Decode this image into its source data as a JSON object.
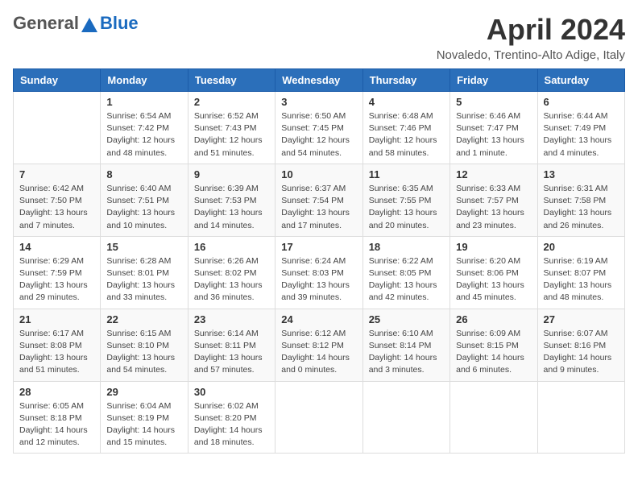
{
  "logo": {
    "general": "General",
    "blue": "Blue"
  },
  "header": {
    "title": "April 2024",
    "location": "Novaledo, Trentino-Alto Adige, Italy"
  },
  "days_of_week": [
    "Sunday",
    "Monday",
    "Tuesday",
    "Wednesday",
    "Thursday",
    "Friday",
    "Saturday"
  ],
  "weeks": [
    [
      {
        "day": "",
        "sunrise": "",
        "sunset": "",
        "daylight": ""
      },
      {
        "day": "1",
        "sunrise": "Sunrise: 6:54 AM",
        "sunset": "Sunset: 7:42 PM",
        "daylight": "Daylight: 12 hours and 48 minutes."
      },
      {
        "day": "2",
        "sunrise": "Sunrise: 6:52 AM",
        "sunset": "Sunset: 7:43 PM",
        "daylight": "Daylight: 12 hours and 51 minutes."
      },
      {
        "day": "3",
        "sunrise": "Sunrise: 6:50 AM",
        "sunset": "Sunset: 7:45 PM",
        "daylight": "Daylight: 12 hours and 54 minutes."
      },
      {
        "day": "4",
        "sunrise": "Sunrise: 6:48 AM",
        "sunset": "Sunset: 7:46 PM",
        "daylight": "Daylight: 12 hours and 58 minutes."
      },
      {
        "day": "5",
        "sunrise": "Sunrise: 6:46 AM",
        "sunset": "Sunset: 7:47 PM",
        "daylight": "Daylight: 13 hours and 1 minute."
      },
      {
        "day": "6",
        "sunrise": "Sunrise: 6:44 AM",
        "sunset": "Sunset: 7:49 PM",
        "daylight": "Daylight: 13 hours and 4 minutes."
      }
    ],
    [
      {
        "day": "7",
        "sunrise": "Sunrise: 6:42 AM",
        "sunset": "Sunset: 7:50 PM",
        "daylight": "Daylight: 13 hours and 7 minutes."
      },
      {
        "day": "8",
        "sunrise": "Sunrise: 6:40 AM",
        "sunset": "Sunset: 7:51 PM",
        "daylight": "Daylight: 13 hours and 10 minutes."
      },
      {
        "day": "9",
        "sunrise": "Sunrise: 6:39 AM",
        "sunset": "Sunset: 7:53 PM",
        "daylight": "Daylight: 13 hours and 14 minutes."
      },
      {
        "day": "10",
        "sunrise": "Sunrise: 6:37 AM",
        "sunset": "Sunset: 7:54 PM",
        "daylight": "Daylight: 13 hours and 17 minutes."
      },
      {
        "day": "11",
        "sunrise": "Sunrise: 6:35 AM",
        "sunset": "Sunset: 7:55 PM",
        "daylight": "Daylight: 13 hours and 20 minutes."
      },
      {
        "day": "12",
        "sunrise": "Sunrise: 6:33 AM",
        "sunset": "Sunset: 7:57 PM",
        "daylight": "Daylight: 13 hours and 23 minutes."
      },
      {
        "day": "13",
        "sunrise": "Sunrise: 6:31 AM",
        "sunset": "Sunset: 7:58 PM",
        "daylight": "Daylight: 13 hours and 26 minutes."
      }
    ],
    [
      {
        "day": "14",
        "sunrise": "Sunrise: 6:29 AM",
        "sunset": "Sunset: 7:59 PM",
        "daylight": "Daylight: 13 hours and 29 minutes."
      },
      {
        "day": "15",
        "sunrise": "Sunrise: 6:28 AM",
        "sunset": "Sunset: 8:01 PM",
        "daylight": "Daylight: 13 hours and 33 minutes."
      },
      {
        "day": "16",
        "sunrise": "Sunrise: 6:26 AM",
        "sunset": "Sunset: 8:02 PM",
        "daylight": "Daylight: 13 hours and 36 minutes."
      },
      {
        "day": "17",
        "sunrise": "Sunrise: 6:24 AM",
        "sunset": "Sunset: 8:03 PM",
        "daylight": "Daylight: 13 hours and 39 minutes."
      },
      {
        "day": "18",
        "sunrise": "Sunrise: 6:22 AM",
        "sunset": "Sunset: 8:05 PM",
        "daylight": "Daylight: 13 hours and 42 minutes."
      },
      {
        "day": "19",
        "sunrise": "Sunrise: 6:20 AM",
        "sunset": "Sunset: 8:06 PM",
        "daylight": "Daylight: 13 hours and 45 minutes."
      },
      {
        "day": "20",
        "sunrise": "Sunrise: 6:19 AM",
        "sunset": "Sunset: 8:07 PM",
        "daylight": "Daylight: 13 hours and 48 minutes."
      }
    ],
    [
      {
        "day": "21",
        "sunrise": "Sunrise: 6:17 AM",
        "sunset": "Sunset: 8:08 PM",
        "daylight": "Daylight: 13 hours and 51 minutes."
      },
      {
        "day": "22",
        "sunrise": "Sunrise: 6:15 AM",
        "sunset": "Sunset: 8:10 PM",
        "daylight": "Daylight: 13 hours and 54 minutes."
      },
      {
        "day": "23",
        "sunrise": "Sunrise: 6:14 AM",
        "sunset": "Sunset: 8:11 PM",
        "daylight": "Daylight: 13 hours and 57 minutes."
      },
      {
        "day": "24",
        "sunrise": "Sunrise: 6:12 AM",
        "sunset": "Sunset: 8:12 PM",
        "daylight": "Daylight: 14 hours and 0 minutes."
      },
      {
        "day": "25",
        "sunrise": "Sunrise: 6:10 AM",
        "sunset": "Sunset: 8:14 PM",
        "daylight": "Daylight: 14 hours and 3 minutes."
      },
      {
        "day": "26",
        "sunrise": "Sunrise: 6:09 AM",
        "sunset": "Sunset: 8:15 PM",
        "daylight": "Daylight: 14 hours and 6 minutes."
      },
      {
        "day": "27",
        "sunrise": "Sunrise: 6:07 AM",
        "sunset": "Sunset: 8:16 PM",
        "daylight": "Daylight: 14 hours and 9 minutes."
      }
    ],
    [
      {
        "day": "28",
        "sunrise": "Sunrise: 6:05 AM",
        "sunset": "Sunset: 8:18 PM",
        "daylight": "Daylight: 14 hours and 12 minutes."
      },
      {
        "day": "29",
        "sunrise": "Sunrise: 6:04 AM",
        "sunset": "Sunset: 8:19 PM",
        "daylight": "Daylight: 14 hours and 15 minutes."
      },
      {
        "day": "30",
        "sunrise": "Sunrise: 6:02 AM",
        "sunset": "Sunset: 8:20 PM",
        "daylight": "Daylight: 14 hours and 18 minutes."
      },
      {
        "day": "",
        "sunrise": "",
        "sunset": "",
        "daylight": ""
      },
      {
        "day": "",
        "sunrise": "",
        "sunset": "",
        "daylight": ""
      },
      {
        "day": "",
        "sunrise": "",
        "sunset": "",
        "daylight": ""
      },
      {
        "day": "",
        "sunrise": "",
        "sunset": "",
        "daylight": ""
      }
    ]
  ]
}
